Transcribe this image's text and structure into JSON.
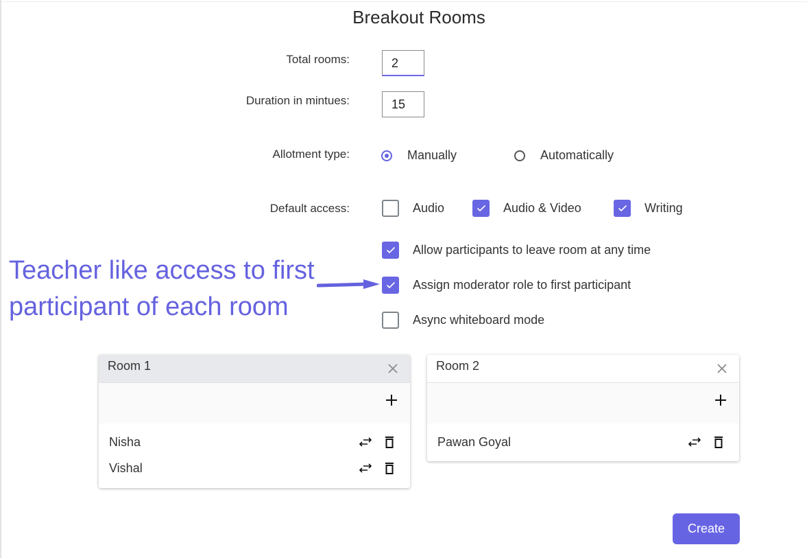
{
  "dialog": {
    "title": "Breakout Rooms"
  },
  "form": {
    "total_rooms": {
      "label": "Total rooms:",
      "value": "2"
    },
    "duration": {
      "label": "Duration in mintues:",
      "value": "15"
    },
    "allotment": {
      "label": "Allotment type:",
      "options": [
        {
          "label": "Manually",
          "selected": true
        },
        {
          "label": "Automatically",
          "selected": false
        }
      ]
    },
    "default_access": {
      "label": "Default access:",
      "options": [
        {
          "label": "Audio",
          "checked": false
        },
        {
          "label": "Audio & Video",
          "checked": true
        },
        {
          "label": "Writing",
          "checked": true
        }
      ]
    },
    "settings": [
      {
        "label": "Allow participants to leave room at any time",
        "checked": true
      },
      {
        "label": "Assign moderator role to first participant",
        "checked": true
      },
      {
        "label": "Async whiteboard mode",
        "checked": false
      }
    ]
  },
  "annotation": {
    "line1": "Teacher like access to first",
    "line2": "participant of each room"
  },
  "rooms": [
    {
      "name": "Room 1",
      "active": true,
      "members": [
        "Nisha",
        "Vishal"
      ]
    },
    {
      "name": "Room 2",
      "active": false,
      "members": [
        "Pawan Goyal"
      ]
    }
  ],
  "actions": {
    "create_label": "Create"
  },
  "colors": {
    "accent": "#6764e4",
    "annotation": "#6562df"
  }
}
